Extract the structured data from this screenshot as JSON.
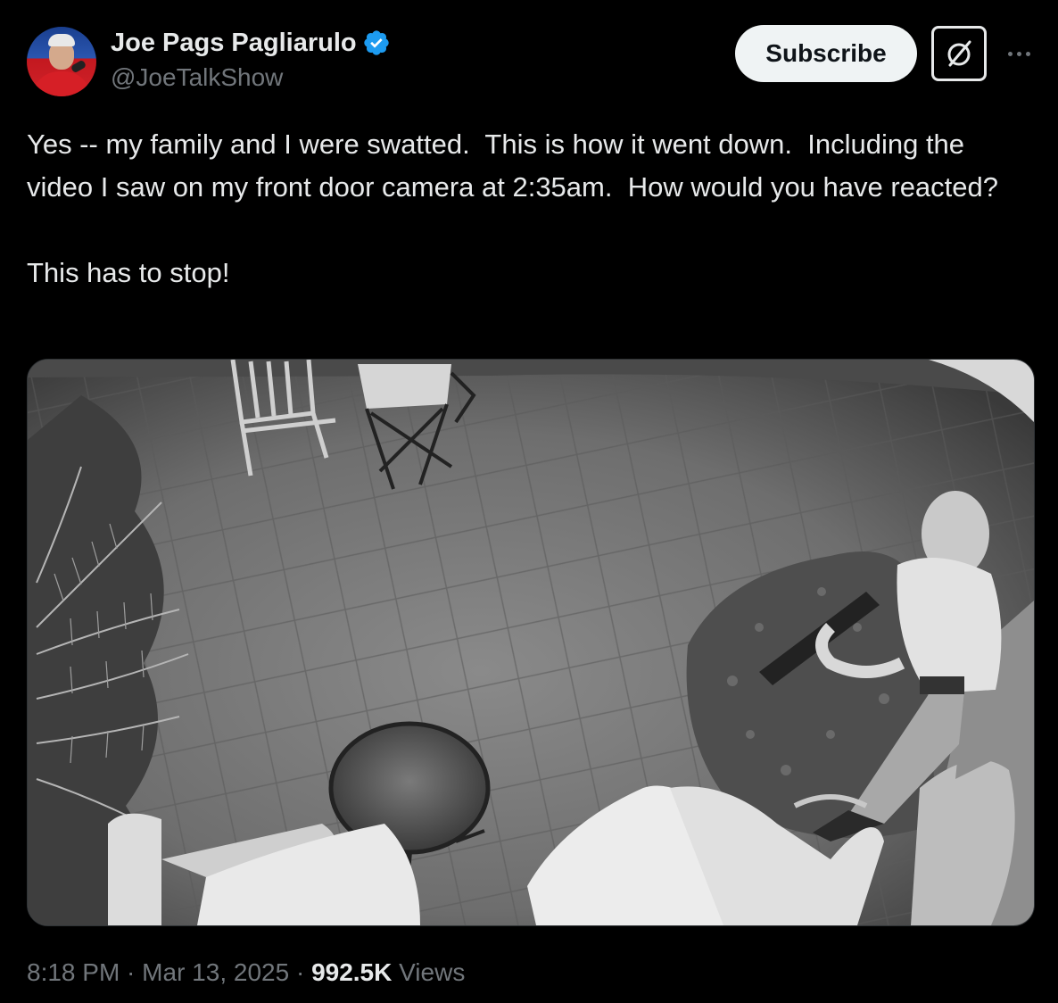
{
  "author": {
    "display_name": "Joe Pags Pagliarulo",
    "handle": "@JoeTalkShow",
    "verified": true
  },
  "header": {
    "subscribe_label": "Subscribe",
    "grok_icon": "slashed-circle-icon",
    "more_icon": "more-horizontal-icon"
  },
  "tweet": {
    "text_paragraph_1": "Yes -- my family and I were swatted.  This is how it went down.  Including the video I saw on my front door camera at 2:35am.  How would you have reacted?",
    "text_paragraph_2": "This has to stop!"
  },
  "meta": {
    "time": "8:18 PM",
    "separator": " · ",
    "date": "Mar 13, 2025",
    "views_count": "992.5K",
    "views_label": "Views"
  },
  "colors": {
    "background": "#000000",
    "text_primary": "#e7e9ea",
    "text_secondary": "#71767b",
    "verified_blue": "#1d9bf0",
    "button_bg": "#eff3f4"
  }
}
